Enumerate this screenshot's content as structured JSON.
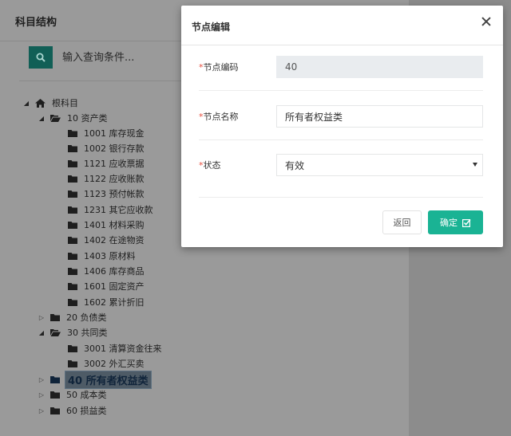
{
  "panel": {
    "title": "科目结构"
  },
  "search": {
    "placeholder": "输入查询条件..."
  },
  "tree": {
    "root": "根科目",
    "nodes": [
      {
        "label": "10 资产类"
      },
      {
        "label": "1001 库存现金"
      },
      {
        "label": "1002 银行存款"
      },
      {
        "label": "1121 应收票据"
      },
      {
        "label": "1122 应收账款"
      },
      {
        "label": "1123 预付帐款"
      },
      {
        "label": "1231 其它应收款"
      },
      {
        "label": "1401 材料采购"
      },
      {
        "label": "1402 在途物资"
      },
      {
        "label": "1403 原材料"
      },
      {
        "label": "1406 库存商品"
      },
      {
        "label": "1601 固定资产"
      },
      {
        "label": "1602 累计折旧"
      },
      {
        "label": "20 负债类"
      },
      {
        "label": "30 共同类"
      },
      {
        "label": "3001 清算资金往来"
      },
      {
        "label": "3002 外汇买卖"
      },
      {
        "label": "40 所有者权益类"
      },
      {
        "label": "50 成本类"
      },
      {
        "label": "60 损益类"
      }
    ]
  },
  "modal": {
    "title": "节点编辑",
    "fields": {
      "code": {
        "required_mark": "*",
        "label": "节点编码",
        "value": "40"
      },
      "name": {
        "required_mark": "*",
        "label": "节点名称",
        "value": "所有者权益类"
      },
      "status": {
        "required_mark": "*",
        "label": "状态",
        "value": "有效"
      }
    },
    "buttons": {
      "back": "返回",
      "confirm": "确定"
    }
  },
  "colors": {
    "accent": "#1ab394",
    "search_button": "#115f56",
    "required": "#e74c3c"
  }
}
